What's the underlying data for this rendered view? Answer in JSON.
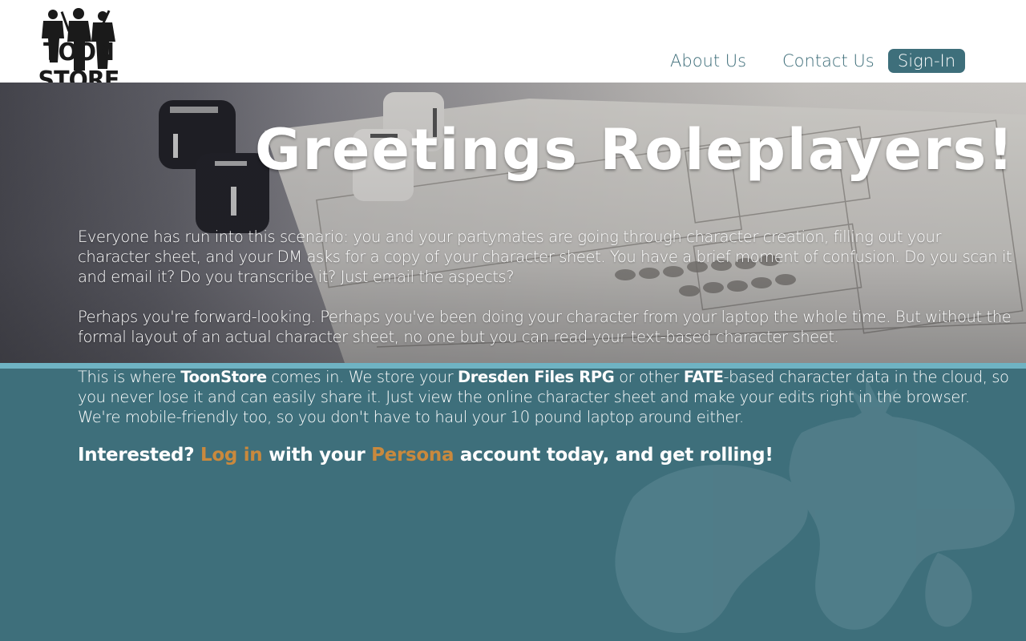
{
  "header": {
    "logo_text": "TOON STORE",
    "nav": {
      "about": "About Us",
      "contact": "Contact Us",
      "signin": "Sign-In"
    }
  },
  "hero": {
    "headline": "Greetings Roleplayers!"
  },
  "content": {
    "p1": "Everyone has run into this scenario: you and your partymates are going through character creation, filling out your character sheet, and your DM asks for a copy of your character sheet. You have a brief moment of confusion. Do you scan it and email it? Do you transcribe it? Just email the aspects?",
    "p2": "Perhaps you're forward-looking. Perhaps you've been doing your character from your laptop the whole time. But without the formal layout of an actual character sheet, no one but you can read your text-based character sheet.",
    "p3": {
      "t1": "This is where ",
      "b1": "ToonStore",
      "t2": " comes in. We store your ",
      "b2": "Dresden Files RPG",
      "t3": " or other ",
      "b3": "FATE",
      "t4": "-based character data in the cloud, so you never lose it and can easily share it. Just view the online character sheet and make your edits right in the browser. We're mobile-friendly too, so you don't have to haul your 10 pound laptop around either."
    },
    "cta": {
      "t1": "Interested? ",
      "login_link": "Log in",
      "t2": " with your ",
      "persona_link": "Persona",
      "t3": " account today, and get rolling!"
    }
  },
  "colors": {
    "accent": "#3e6f7b",
    "stripe": "#6fb3c3",
    "link": "#c9893d"
  }
}
